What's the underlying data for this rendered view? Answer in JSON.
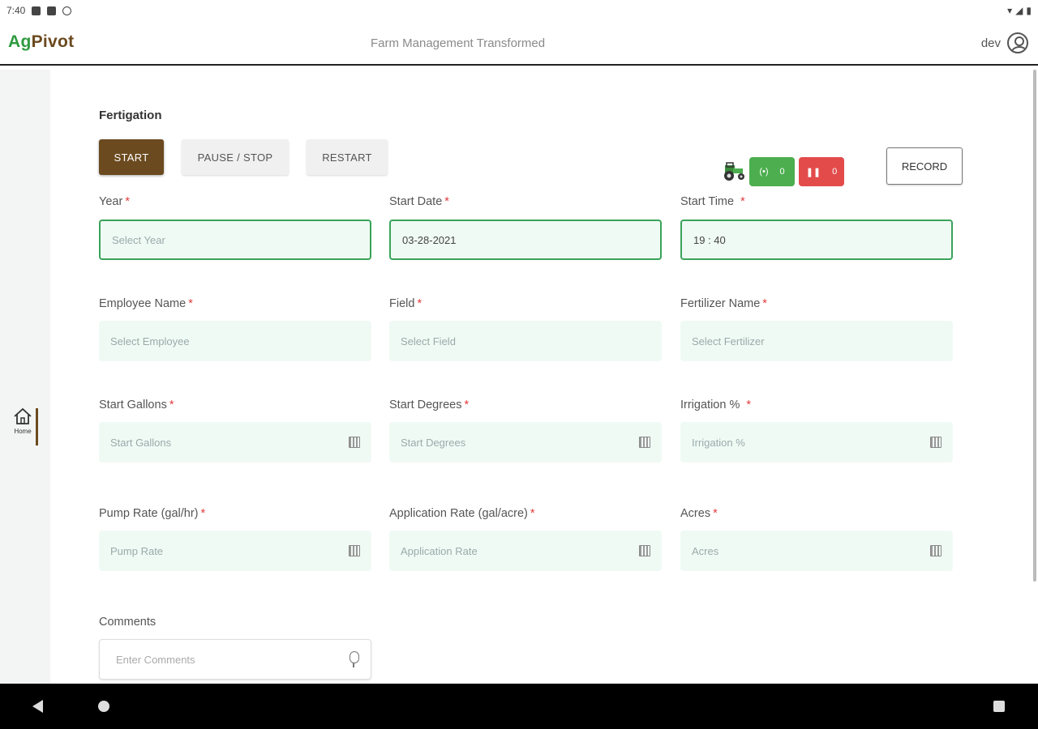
{
  "status": {
    "time": "7:40"
  },
  "header": {
    "logo_ag": "Ag",
    "logo_pivot": "Pivot",
    "tagline": "Farm Management Transformed",
    "username": "dev"
  },
  "sidebar": {
    "home_label": "Home"
  },
  "page": {
    "title": "Fertigation"
  },
  "controls": {
    "start_label": "START",
    "pause_label": "PAUSE / STOP",
    "restart_label": "RESTART",
    "record_label": "RECORD",
    "green_count": "0",
    "red_count": "0"
  },
  "fields": {
    "year": {
      "label": "Year",
      "placeholder": "Select Year",
      "value": ""
    },
    "start_date": {
      "label": "Start Date",
      "value": "03-28-2021"
    },
    "start_time": {
      "label": "Start Time",
      "value": "19 : 40"
    },
    "employee": {
      "label": "Employee Name",
      "placeholder": "Select Employee"
    },
    "field": {
      "label": "Field",
      "placeholder": "Select Field"
    },
    "fertilizer": {
      "label": "Fertilizer Name",
      "placeholder": "Select Fertilizer"
    },
    "start_gallons": {
      "label": "Start Gallons",
      "placeholder": "Start Gallons"
    },
    "start_degrees": {
      "label": "Start Degrees",
      "placeholder": "Start Degrees"
    },
    "irrigation": {
      "label": "Irrigation %",
      "placeholder": "Irrigation %"
    },
    "pump_rate": {
      "label": "Pump Rate (gal/hr)",
      "placeholder": "Pump Rate"
    },
    "application_rate": {
      "label": "Application Rate (gal/acre)",
      "placeholder": "Application Rate"
    },
    "acres": {
      "label": "Acres",
      "placeholder": "Acres"
    },
    "comments": {
      "label": "Comments",
      "placeholder": "Enter Comments"
    }
  },
  "required_mark": "*"
}
